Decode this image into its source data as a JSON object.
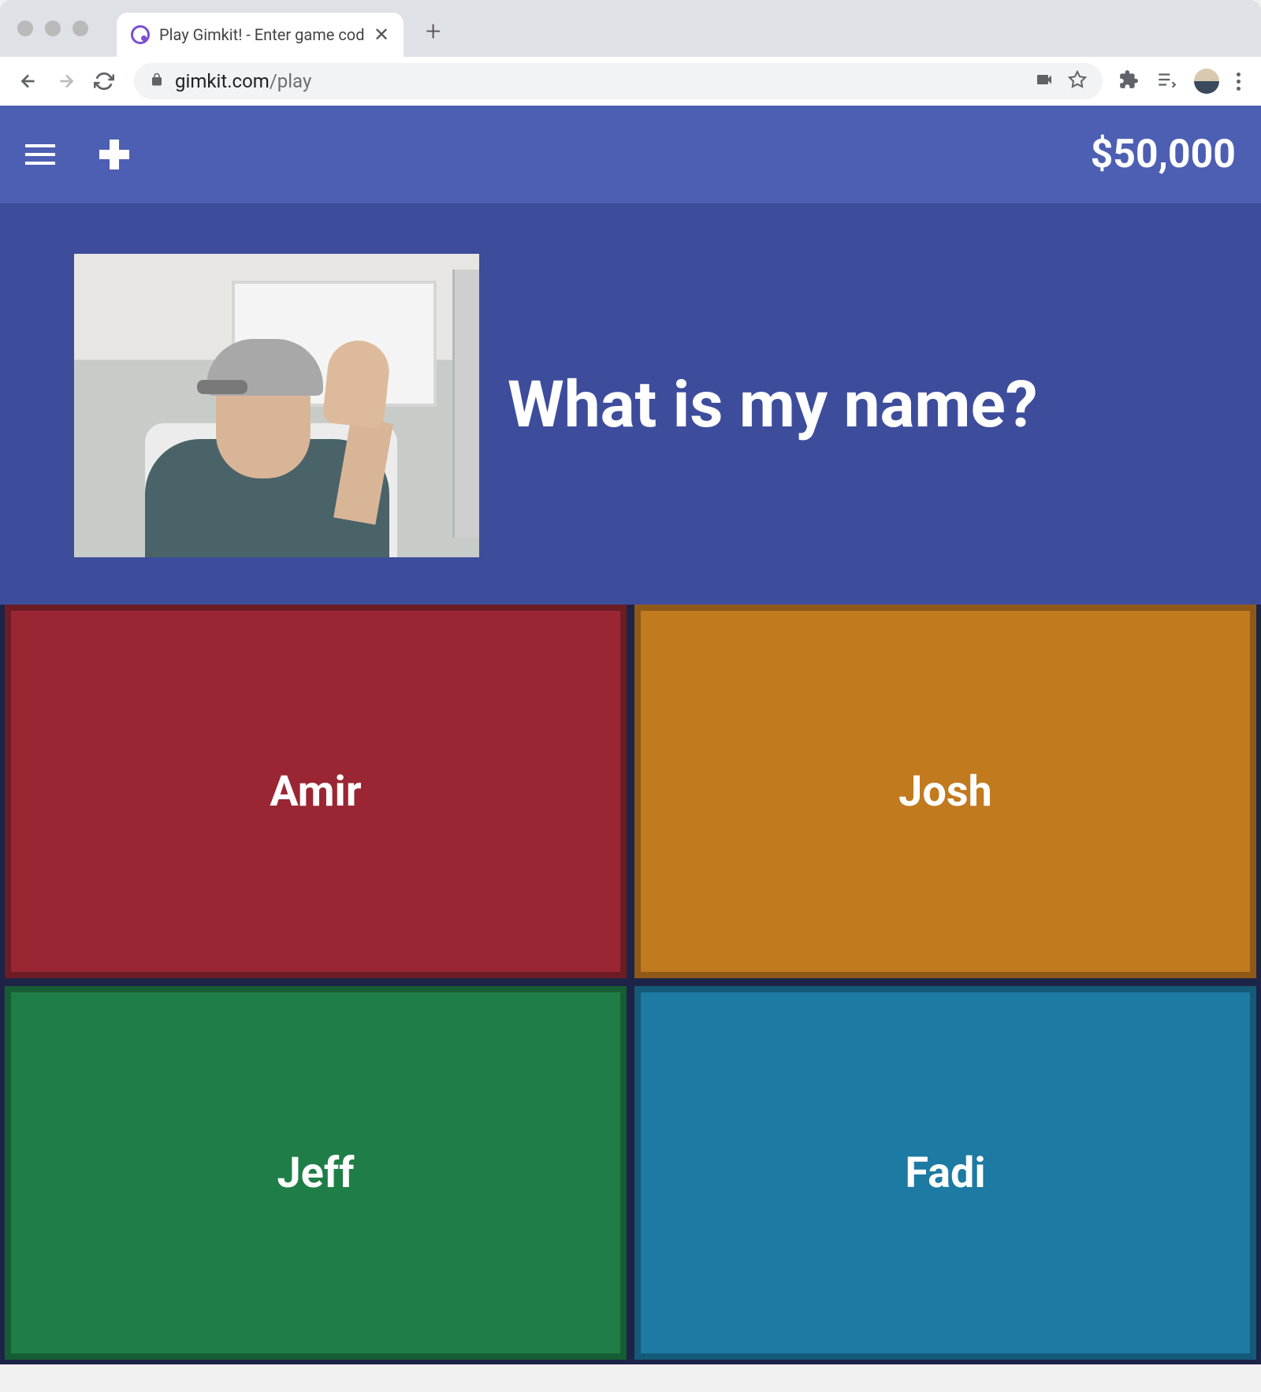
{
  "browser": {
    "tab_title": "Play Gimkit! - Enter game code",
    "url_domain": "gimkit.com",
    "url_path": "/play"
  },
  "game": {
    "money": "$50,000",
    "question": "What is my name?",
    "answers": [
      {
        "label": "Amir"
      },
      {
        "label": "Josh"
      },
      {
        "label": "Jeff"
      },
      {
        "label": "Fadi"
      }
    ]
  }
}
